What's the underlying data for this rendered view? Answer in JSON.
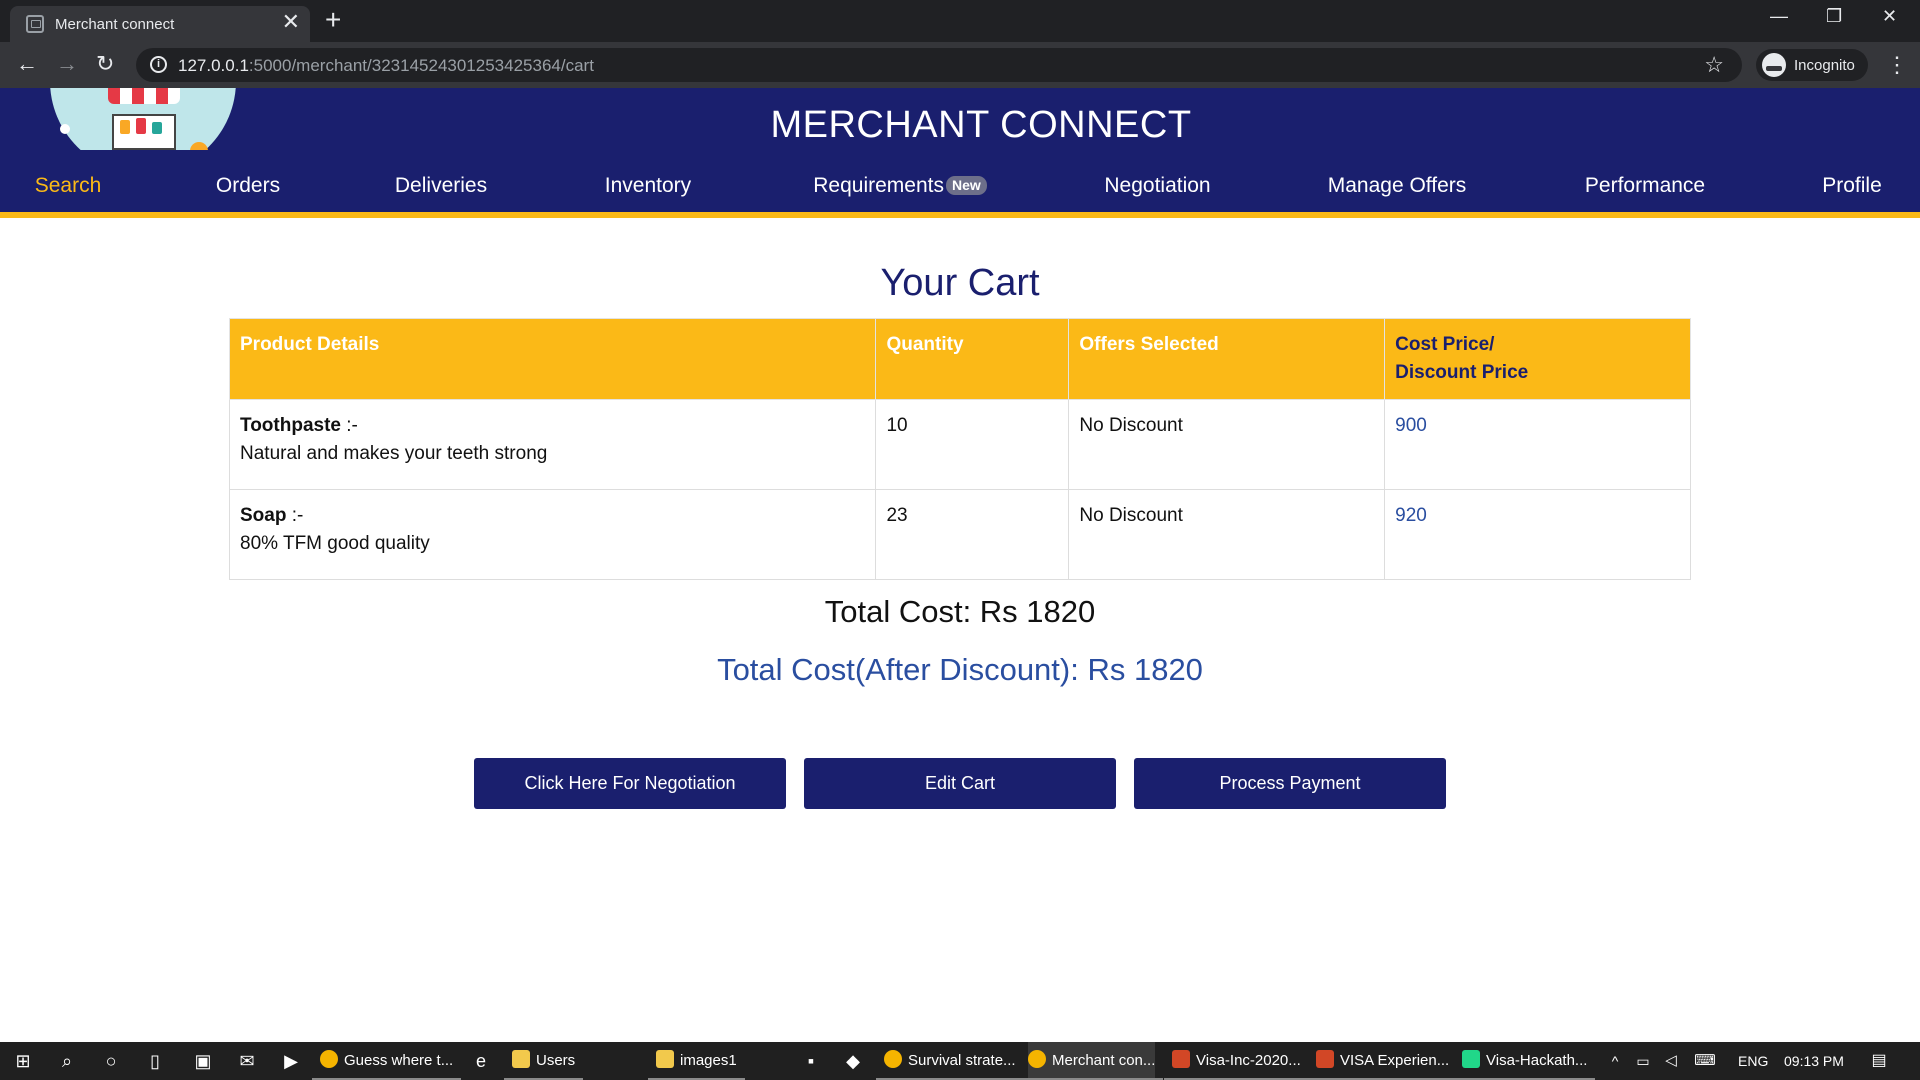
{
  "browser": {
    "tab_title": "Merchant connect",
    "tab_close": "✕",
    "new_tab": "+",
    "url_host": "127.0.0.1",
    "url_path": ":5000/merchant/32314524301253425364/cart",
    "profile_label": "Incognito",
    "icons": [
      "back-icon",
      "forward-icon",
      "reload-icon",
      "info-icon",
      "star-icon",
      "incognito-icon",
      "menu-icon",
      "minimize-icon",
      "restore-icon",
      "close-icon"
    ]
  },
  "site": {
    "brand": "MERCHANT CONNECT",
    "nav": [
      {
        "label": "Search",
        "active": true
      },
      {
        "label": "Orders"
      },
      {
        "label": "Deliveries"
      },
      {
        "label": "Inventory"
      },
      {
        "label": "Requirements",
        "badge": "New"
      },
      {
        "label": "Negotiation"
      },
      {
        "label": "Manage Offers"
      },
      {
        "label": "Performance"
      },
      {
        "label": "Profile"
      }
    ],
    "accent_color": "#fbb917",
    "primary_color": "#1a1f6e"
  },
  "cart": {
    "title": "Your Cart",
    "headers": {
      "product": "Product Details",
      "quantity": "Quantity",
      "offers": "Offers Selected",
      "price_line1": "Cost Price/",
      "price_line2": "Discount Price"
    },
    "rows": [
      {
        "name": "Toothpaste",
        "sep": " :-",
        "desc": "Natural and makes your teeth strong",
        "quantity": "10",
        "offer": "No Discount",
        "price": "900"
      },
      {
        "name": "Soap",
        "sep": " :-",
        "desc": "80% TFM good quality",
        "quantity": "23",
        "offer": "No Discount",
        "price": "920"
      }
    ],
    "total": "Total Cost: Rs 1820",
    "total_after_discount": "Total Cost(After Discount): Rs 1820",
    "buttons": {
      "negotiate": "Click Here For Negotiation",
      "edit": "Edit Cart",
      "pay": "Process Payment"
    }
  },
  "taskbar": {
    "apps": [
      {
        "label": "Guess where t...",
        "color": "#f5b400"
      },
      {
        "label": "Users",
        "color": "#f2c94c"
      },
      {
        "label": "images1",
        "color": "#f2c94c"
      },
      {
        "label": "Survival strate...",
        "color": "#f5b400"
      },
      {
        "label": "Merchant con...",
        "color": "#f5b400"
      },
      {
        "label": "Visa-Inc-2020...",
        "color": "#d24726"
      },
      {
        "label": "VISA Experien...",
        "color": "#d24726"
      },
      {
        "label": "Visa-Hackath...",
        "color": "#21d789"
      }
    ],
    "lang": "ENG",
    "time": "09:13 PM"
  }
}
